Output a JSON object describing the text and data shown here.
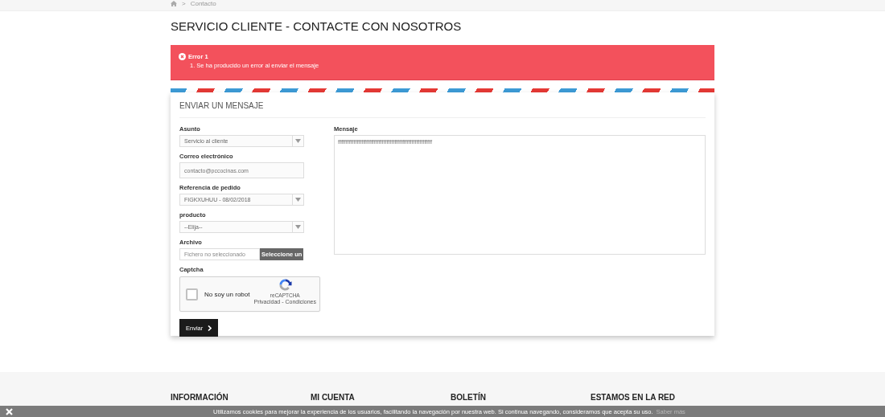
{
  "breadcrumb": {
    "separator": ">",
    "current": "Contacto"
  },
  "page_title": "SERVICIO CLIENTE - CONTACTE CON NOSOTROS",
  "alert": {
    "title": "Error 1",
    "messages": [
      "1. Se ha producido un error al enviar el mensaje"
    ]
  },
  "form": {
    "heading": "ENVIAR UN MENSAJE",
    "fields": [
      {
        "kind": "select",
        "label": "Asunto",
        "value": "Servicio al cliente"
      },
      {
        "kind": "text",
        "label": "Correo electrónico",
        "placeholder": "contacto@pccocinas.com"
      },
      {
        "kind": "select",
        "label": "Referencia de pedido",
        "value": "FIGKXUHUU - 08/02/2018"
      },
      {
        "kind": "select",
        "label": "producto",
        "value": "--Elija--"
      },
      {
        "kind": "file",
        "label": "Archivo",
        "value": "Fichero no seleccionado",
        "button": "Seleccione un"
      }
    ],
    "captcha": {
      "label": "Captcha",
      "checkbox_label": "No soy un robot",
      "checked": false,
      "brand": "reCAPTCHA",
      "links": "Privacidad - Condiciones"
    },
    "message": {
      "label": "Mensaje",
      "value": "ffffffffffffffffffffffffffffffffffffffffffffffffffffffffffff"
    },
    "submit": "Enviar"
  },
  "footer": {
    "columns": [
      {
        "heading": "INFORMACIÓN"
      },
      {
        "heading": "MI CUENTA"
      },
      {
        "heading": "BOLETÍN"
      },
      {
        "heading": "ESTAMOS EN LA RED"
      }
    ]
  },
  "cookie_bar": {
    "text": "Utilizamos cookies para mejorar la experiencia de los usuarios, facilitando la navegación por nuestra web. Si continua navegando, consideramos que acepta su uso.",
    "link": "Saber más"
  }
}
